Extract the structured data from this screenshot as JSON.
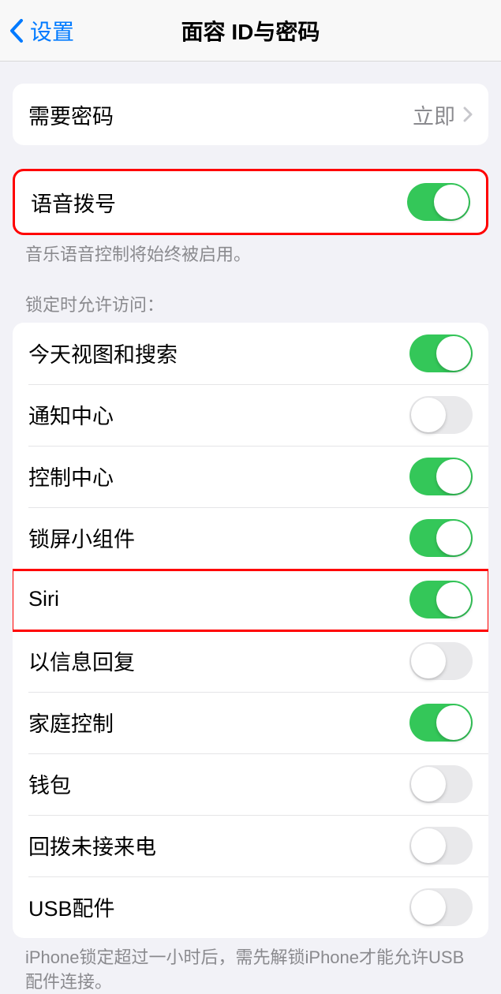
{
  "nav": {
    "back_label": "设置",
    "title": "面容 ID与密码"
  },
  "require_passcode": {
    "label": "需要密码",
    "value": "立即"
  },
  "voice_dial": {
    "label": "语音拨号",
    "on": true,
    "footer": "音乐语音控制将始终被启用。"
  },
  "lock_access": {
    "header": "锁定时允许访问：",
    "items": [
      {
        "label": "今天视图和搜索",
        "on": true
      },
      {
        "label": "通知中心",
        "on": false
      },
      {
        "label": "控制中心",
        "on": true
      },
      {
        "label": "锁屏小组件",
        "on": true
      },
      {
        "label": "Siri",
        "on": true
      },
      {
        "label": "以信息回复",
        "on": false
      },
      {
        "label": "家庭控制",
        "on": true
      },
      {
        "label": "钱包",
        "on": false
      },
      {
        "label": "回拨未接来电",
        "on": false
      },
      {
        "label": "USB配件",
        "on": false
      }
    ],
    "footer": "iPhone锁定超过一小时后，需先解锁iPhone才能允许USB配件连接。"
  }
}
